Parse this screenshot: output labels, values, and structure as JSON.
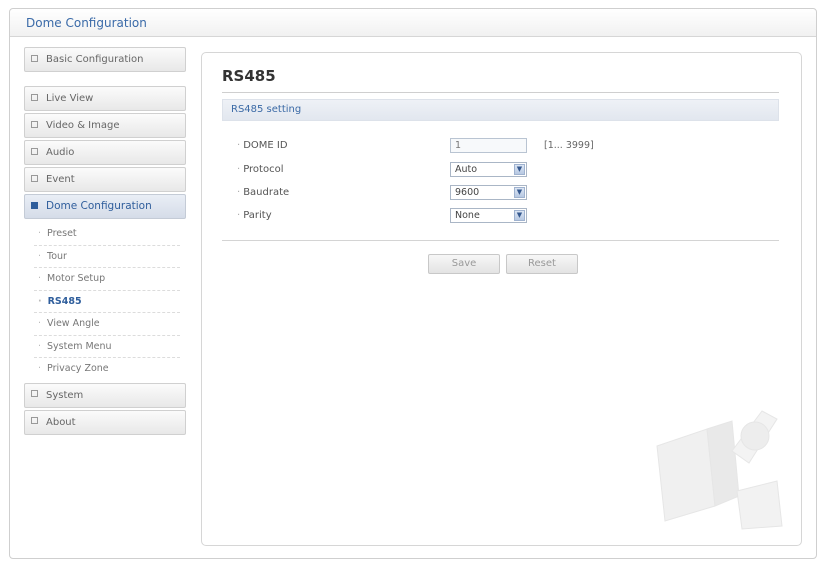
{
  "header": {
    "title": "Dome Configuration"
  },
  "sidebar": {
    "basic": "Basic Configuration",
    "items": [
      "Live View",
      "Video & Image",
      "Audio",
      "Event",
      "Dome Configuration"
    ],
    "sub_items": [
      "Preset",
      "Tour",
      "Motor Setup",
      "RS485",
      "View Angle",
      "System Menu",
      "Privacy Zone"
    ],
    "bottom_items": [
      "System",
      "About"
    ]
  },
  "main": {
    "title": "RS485",
    "section_title": "RS485 setting",
    "fields": {
      "dome_id": {
        "label": "DOME ID",
        "value": "1",
        "hint": "[1... 3999]"
      },
      "protocol": {
        "label": "Protocol",
        "value": "Auto"
      },
      "baudrate": {
        "label": "Baudrate",
        "value": "9600"
      },
      "parity": {
        "label": "Parity",
        "value": "None"
      }
    },
    "buttons": {
      "save": "Save",
      "reset": "Reset"
    }
  },
  "colors": {
    "accent": "#2f5e9c",
    "link": "#3a6aa8"
  }
}
